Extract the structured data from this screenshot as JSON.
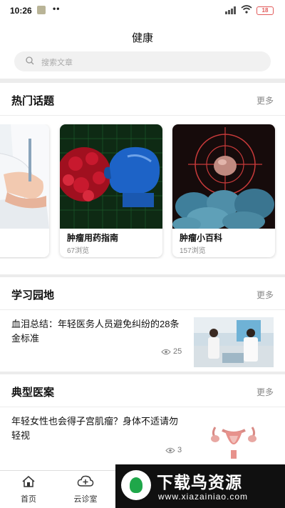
{
  "status_bar": {
    "time": "10:26",
    "dots": "••",
    "battery": "18"
  },
  "header": {
    "title": "健康",
    "search_placeholder": "搜索文章"
  },
  "hot_topics": {
    "heading": "热门话题",
    "more": "更多",
    "cards": [
      {
        "title": "",
        "views": ""
      },
      {
        "title": "肿瘤用药指南",
        "views": "67浏览"
      },
      {
        "title": "肿瘤小百科",
        "views": "157浏览"
      }
    ]
  },
  "study": {
    "heading": "学习园地",
    "more": "更多",
    "articles": [
      {
        "title": "血泪总结：年轻医务人员避免纠纷的28条金标准",
        "views": "25"
      }
    ]
  },
  "cases": {
    "heading": "典型医案",
    "more": "更多",
    "articles": [
      {
        "title": "年轻女性也会得子宫肌瘤？身体不适请勿轻视",
        "views": "3"
      }
    ]
  },
  "bottom_nav": {
    "items": [
      {
        "label": "首页",
        "icon": "home-icon"
      },
      {
        "label": "云诊室",
        "icon": "cloud-plus-icon"
      }
    ]
  },
  "watermark": {
    "name": "下载鸟资源",
    "url": "www.xiazainiao.com"
  },
  "colors": {
    "accent_red": "#c2102b",
    "boxing_blue": "#1d63c7",
    "cell_teal": "#4f8ea8",
    "watermark_green": "#1fa74a"
  }
}
